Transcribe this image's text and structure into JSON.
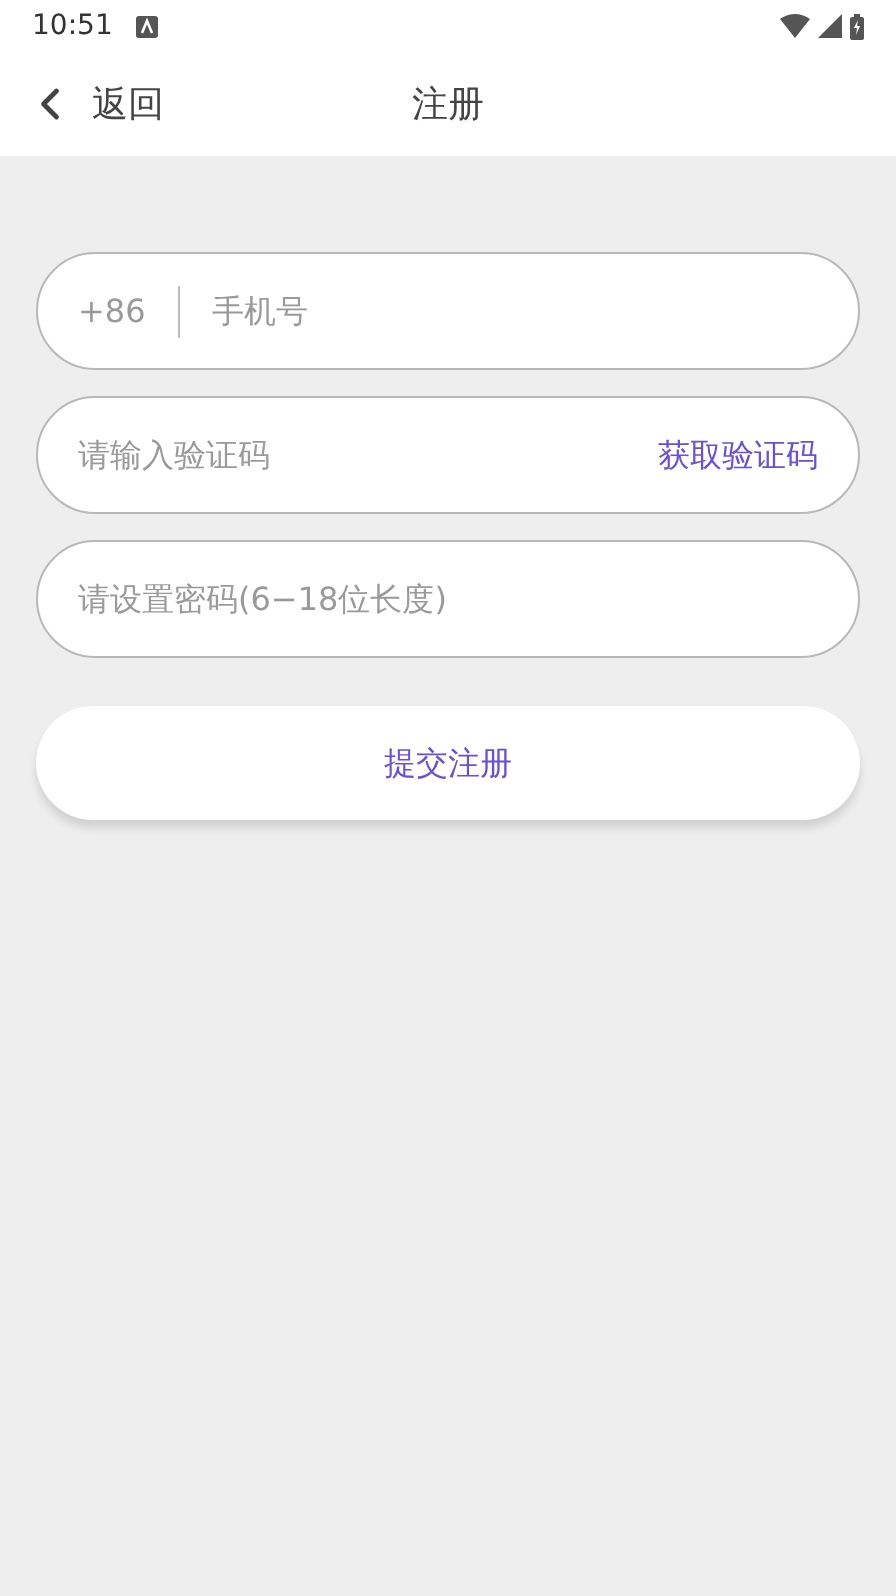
{
  "status_bar": {
    "time": "10:51"
  },
  "header": {
    "back_label": "返回",
    "title": "注册"
  },
  "fields": [
    {
      "kind": "phone",
      "prefix": "+86",
      "placeholder": "手机号"
    },
    {
      "kind": "code",
      "placeholder": "请输入验证码",
      "action": "获取验证码"
    },
    {
      "kind": "password",
      "placeholder": "请设置密码(6−18位长度)"
    }
  ],
  "submit": {
    "label": "提交注册"
  }
}
